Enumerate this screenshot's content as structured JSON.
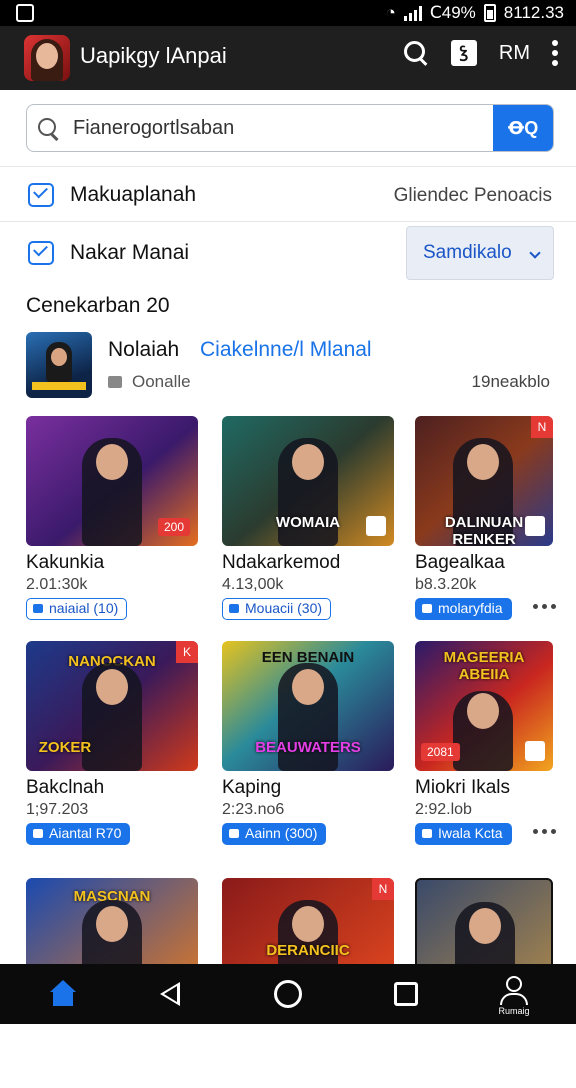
{
  "status_bar": {
    "battery": "Ⅽ49%",
    "time": "8112.33"
  },
  "app_bar": {
    "title": "Uapikgy lAnpai",
    "tt_icon": "ꝣ",
    "rm_label": "RM"
  },
  "search": {
    "value": "Fianerogortlsaban",
    "button_label": "ꝊQ"
  },
  "filter_rows": [
    {
      "label": "Makuaplanah",
      "right_text": "Gliendec Penoacis"
    },
    {
      "label": "Nakar Manai",
      "dropdown": "Samdikalo"
    }
  ],
  "section_title": "Cenekarban 20",
  "featured": {
    "title": "Nolaiah",
    "link": "Ciakelnne/l Mlanal",
    "subtitle": "Oonalle",
    "right_text": "19neakblo"
  },
  "games": [
    {
      "name": "Kakunkia",
      "count": "2.01:30k",
      "tag": "naiaial (10)",
      "badge": "200",
      "banner": "",
      "tag_style": "light"
    },
    {
      "name": "Ndakarkemod",
      "count": "4.13,00k",
      "tag": "Mouacii (30)",
      "banner": "WOMAIA",
      "tag_style": "light"
    },
    {
      "name": "Bagealkaa",
      "count": "b8.3.20k",
      "tag": "molaryfdia",
      "banner": "DALINUAN RENKER",
      "corner": "N",
      "tag_style": "solid",
      "dots": true
    },
    {
      "name": "Bakclnah",
      "count": "1;97.203",
      "tag": "Aiantal R70",
      "banner": "ZOKER",
      "corner": "K",
      "title_banner": "NANOCKAN",
      "tag_style": "solid"
    },
    {
      "name": "Kaping",
      "count": "2:23.no6",
      "tag": "Aainn (300)",
      "banner": "BEAUWATERS",
      "title_banner": "EEN BENAIN",
      "tag_style": "solid"
    },
    {
      "name": "Miokri Ikals",
      "count": "2:92.lob",
      "tag": "Iwala Kcta",
      "badge": "2081",
      "title_banner": "MAGEERIA ABEIIA",
      "tag_style": "solid",
      "dots": true
    },
    {
      "name": "",
      "count": "",
      "tag": "",
      "title_banner": "MASCNAN"
    },
    {
      "name": "",
      "count": "",
      "tag": "",
      "title_banner": "DERANCIIC",
      "corner": "N"
    },
    {
      "name": "",
      "count": "",
      "tag": ""
    }
  ],
  "nav": {
    "profile_label": "Rumaig"
  }
}
